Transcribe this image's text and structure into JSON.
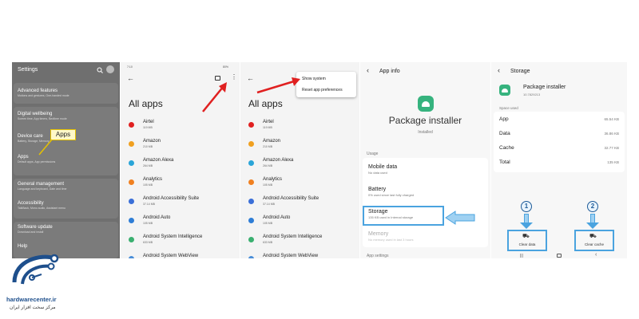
{
  "panel1": {
    "title": "Settings",
    "items": [
      {
        "label": "Advanced features",
        "sub": "Motions and gestures, One-handed mode"
      },
      {
        "label": "Digital wellbeing",
        "sub": "Screen time, App timers, Bedtime mode"
      },
      {
        "label": "Device care",
        "sub": "Battery, Storage, Memory"
      },
      {
        "label": "Apps",
        "sub": "Default apps, App permissions"
      },
      {
        "label": "General management",
        "sub": "Language and keyboard, Date and time"
      },
      {
        "label": "Accessibility",
        "sub": "TalkBack, Mono audio, Assistant menu"
      },
      {
        "label": "Software update",
        "sub": "Download and install"
      },
      {
        "label": "Help",
        "sub": ""
      }
    ],
    "callout": "Apps"
  },
  "panel2": {
    "status": "7:10",
    "battery": "80%",
    "title": "All apps",
    "apps": [
      {
        "name": "Airtel",
        "size": "119 MB",
        "color": "#e02020"
      },
      {
        "name": "Amazon",
        "size": "210 MB",
        "color": "#f0a020"
      },
      {
        "name": "Amazon Alexa",
        "size": "264 MB",
        "color": "#2aa5d8"
      },
      {
        "name": "Analytics",
        "size": "105 MB",
        "color": "#f08020"
      },
      {
        "name": "Android Accessibility Suite",
        "size": "37.14 MB",
        "color": "#3a6fd8"
      },
      {
        "name": "Android Auto",
        "size": "105 MB",
        "color": "#2e7dd6"
      },
      {
        "name": "Android System Intelligence",
        "size": "633 MB",
        "color": "#3ab070"
      },
      {
        "name": "Android System WebView",
        "size": "",
        "color": "#4a8ed8"
      }
    ]
  },
  "panel3": {
    "title": "All apps",
    "menu": [
      "Show system",
      "Reset app preferences"
    ]
  },
  "panel4": {
    "header": "App info",
    "app_name": "Package installer",
    "app_status": "Installed",
    "section_usage": "Usage",
    "items": [
      {
        "label": "Mobile data",
        "sub": "No data used"
      },
      {
        "label": "Battery",
        "sub": "0% used since last fully charged"
      },
      {
        "label": "Storage",
        "sub": "135 KB used in Internal storage"
      },
      {
        "label": "Memory",
        "sub": "No memory used in last 3 hours"
      }
    ],
    "section_settings": "App settings"
  },
  "panel5": {
    "header": "Storage",
    "app_name": "Package installer",
    "version": "10.7829213",
    "section": "Space used",
    "rows": [
      {
        "label": "App",
        "value": "65.54 KB"
      },
      {
        "label": "Data",
        "value": "36.86 KB"
      },
      {
        "label": "Cache",
        "value": "32.77 KB"
      },
      {
        "label": "Total",
        "value": "135 KB"
      }
    ],
    "clear_data": "Clear data",
    "clear_cache": "Clear cache",
    "badge1": "1",
    "badge2": "2"
  },
  "logo": {
    "site": "hardwarecenter.ir",
    "tagline": "مرکز سخت افزار ایران",
    "accent": "#1e4f8c"
  }
}
